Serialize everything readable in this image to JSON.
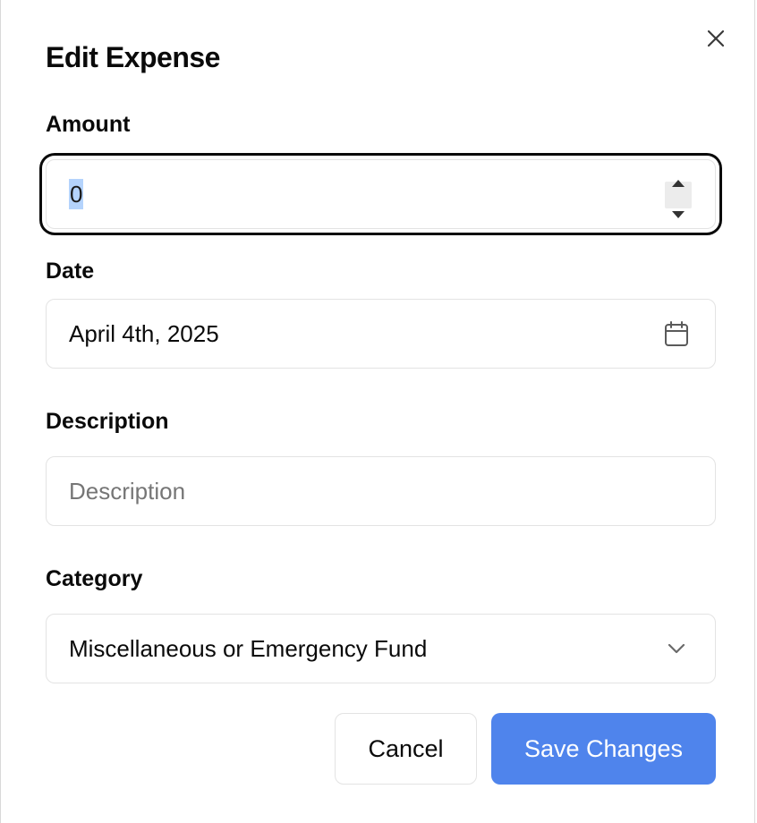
{
  "dialog": {
    "title": "Edit Expense",
    "close_icon": "close-icon"
  },
  "form": {
    "amount": {
      "label": "Amount",
      "value": "0"
    },
    "date": {
      "label": "Date",
      "value": "April 4th, 2025",
      "icon": "calendar-icon"
    },
    "description": {
      "label": "Description",
      "value": "",
      "placeholder": "Description"
    },
    "category": {
      "label": "Category",
      "selected": "Miscellaneous or Emergency Fund",
      "icon": "chevron-down-icon"
    }
  },
  "actions": {
    "cancel_label": "Cancel",
    "save_label": "Save Changes"
  },
  "colors": {
    "primary": "#4f84ec",
    "focus_ring": "#0a0a0a",
    "border": "#e3e3e3",
    "selection": "#b4d3fc"
  }
}
